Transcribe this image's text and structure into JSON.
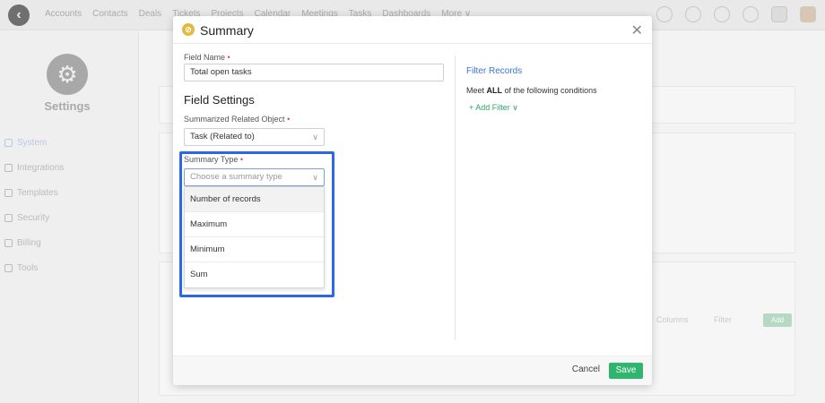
{
  "topnav": [
    "Accounts",
    "Contacts",
    "Deals",
    "Tickets",
    "Projects",
    "Calendar",
    "Meetings",
    "Tasks",
    "Dashboards",
    "More ∨"
  ],
  "leftcol": {
    "title": "Settings",
    "items": [
      "System",
      "Integrations",
      "Templates",
      "Security",
      "Billing",
      "Tools"
    ]
  },
  "bg": {
    "columns": "Columns",
    "filter": "Filter",
    "add": "Add"
  },
  "modal": {
    "title": "Summary",
    "field_name_label": "Field Name",
    "field_name_value": "Total open tasks",
    "section_title": "Field Settings",
    "related_label": "Summarized Related Object",
    "related_value": "Task (Related to)",
    "summary_type_label": "Summary Type",
    "summary_type_placeholder": "Choose a summary type",
    "options": [
      "Number of records",
      "Maximum",
      "Minimum",
      "Sum"
    ],
    "filter_title": "Filter Records",
    "filter_cond_prefix": "Meet ",
    "filter_cond_bold": "ALL",
    "filter_cond_suffix": " of the following conditions",
    "add_filter": "+ Add Filter ∨",
    "cancel": "Cancel",
    "save": "Save",
    "required_mark": "•"
  },
  "colors": {
    "highlight": "#2b68e6",
    "save": "#2fb56e",
    "link": "#3d74d8",
    "required": "#e0484f"
  }
}
